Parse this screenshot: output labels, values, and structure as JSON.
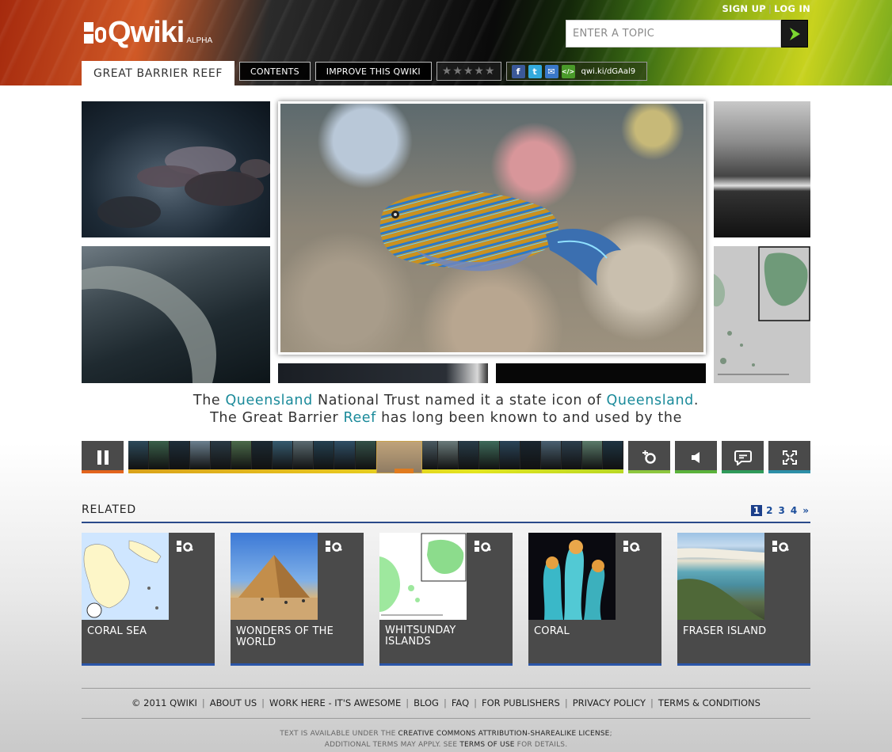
{
  "header": {
    "logo_text": "Qwiki",
    "logo_badge": "ALPHA",
    "sign_up": "SIGN UP",
    "auth_separator": "|",
    "log_in": "LOG IN",
    "search": {
      "placeholder": "ENTER A TOPIC",
      "value": ""
    },
    "topic_tab": "GREAT BARRIER REEF",
    "contents_btn": "CONTENTS",
    "improve_btn": "IMPROVE THIS QWIKI",
    "rating": {
      "stars_total": 5,
      "stars_filled": 0,
      "glyphs": "★★★★★"
    },
    "share": {
      "facebook_glyph": "f",
      "twitter_glyph": "t",
      "email_glyph": "✉",
      "embed_glyph": "</>",
      "short_url": "qwi.ki/dGAal9"
    }
  },
  "caption": {
    "line1": [
      {
        "text": "The ",
        "link": false
      },
      {
        "text": "Queensland",
        "link": true
      },
      {
        "text": " National Trust named it a state icon of ",
        "link": false
      },
      {
        "text": "Queensland",
        "link": true
      },
      {
        "text": ".",
        "link": false
      }
    ],
    "line2": [
      {
        "text": "The Great Barrier ",
        "link": false
      },
      {
        "text": "Reef",
        "link": true
      },
      {
        "text": " has long been known to and used by the",
        "link": false
      }
    ]
  },
  "player": {
    "timeline_progress": 0.54
  },
  "related": {
    "title": "RELATED",
    "pages": [
      "1",
      "2",
      "3",
      "4",
      "»"
    ],
    "current_page": "1",
    "cards": [
      {
        "label": "CORAL SEA"
      },
      {
        "label": "WONDERS OF THE WORLD"
      },
      {
        "label": "WHITSUNDAY ISLANDS"
      },
      {
        "label": "CORAL"
      },
      {
        "label": "FRASER ISLAND"
      }
    ]
  },
  "footer": {
    "links": [
      "© 2011 QWIKI",
      "ABOUT US",
      "WORK HERE - IT'S AWESOME",
      "BLOG",
      "FAQ",
      "FOR PUBLISHERS",
      "PRIVACY POLICY",
      "TERMS & CONDITIONS"
    ],
    "separator": "|",
    "license_line1_prefix": "TEXT IS AVAILABLE UNDER THE ",
    "license_line1_link": "CREATIVE COMMONS ATTRIBUTION-SHAREALIKE LICENSE",
    "license_line1_suffix": ";",
    "license_line2_prefix": "ADDITIONAL TERMS MAY APPLY. SEE ",
    "license_line2_link": "TERMS OF USE",
    "license_line2_suffix": " FOR DETAILS."
  },
  "colors": {
    "link_teal": "#1a8a9a",
    "accent_blue": "#2b55a8",
    "pause_orange": "#e2641d",
    "control_gray": "#4a4a4a"
  }
}
